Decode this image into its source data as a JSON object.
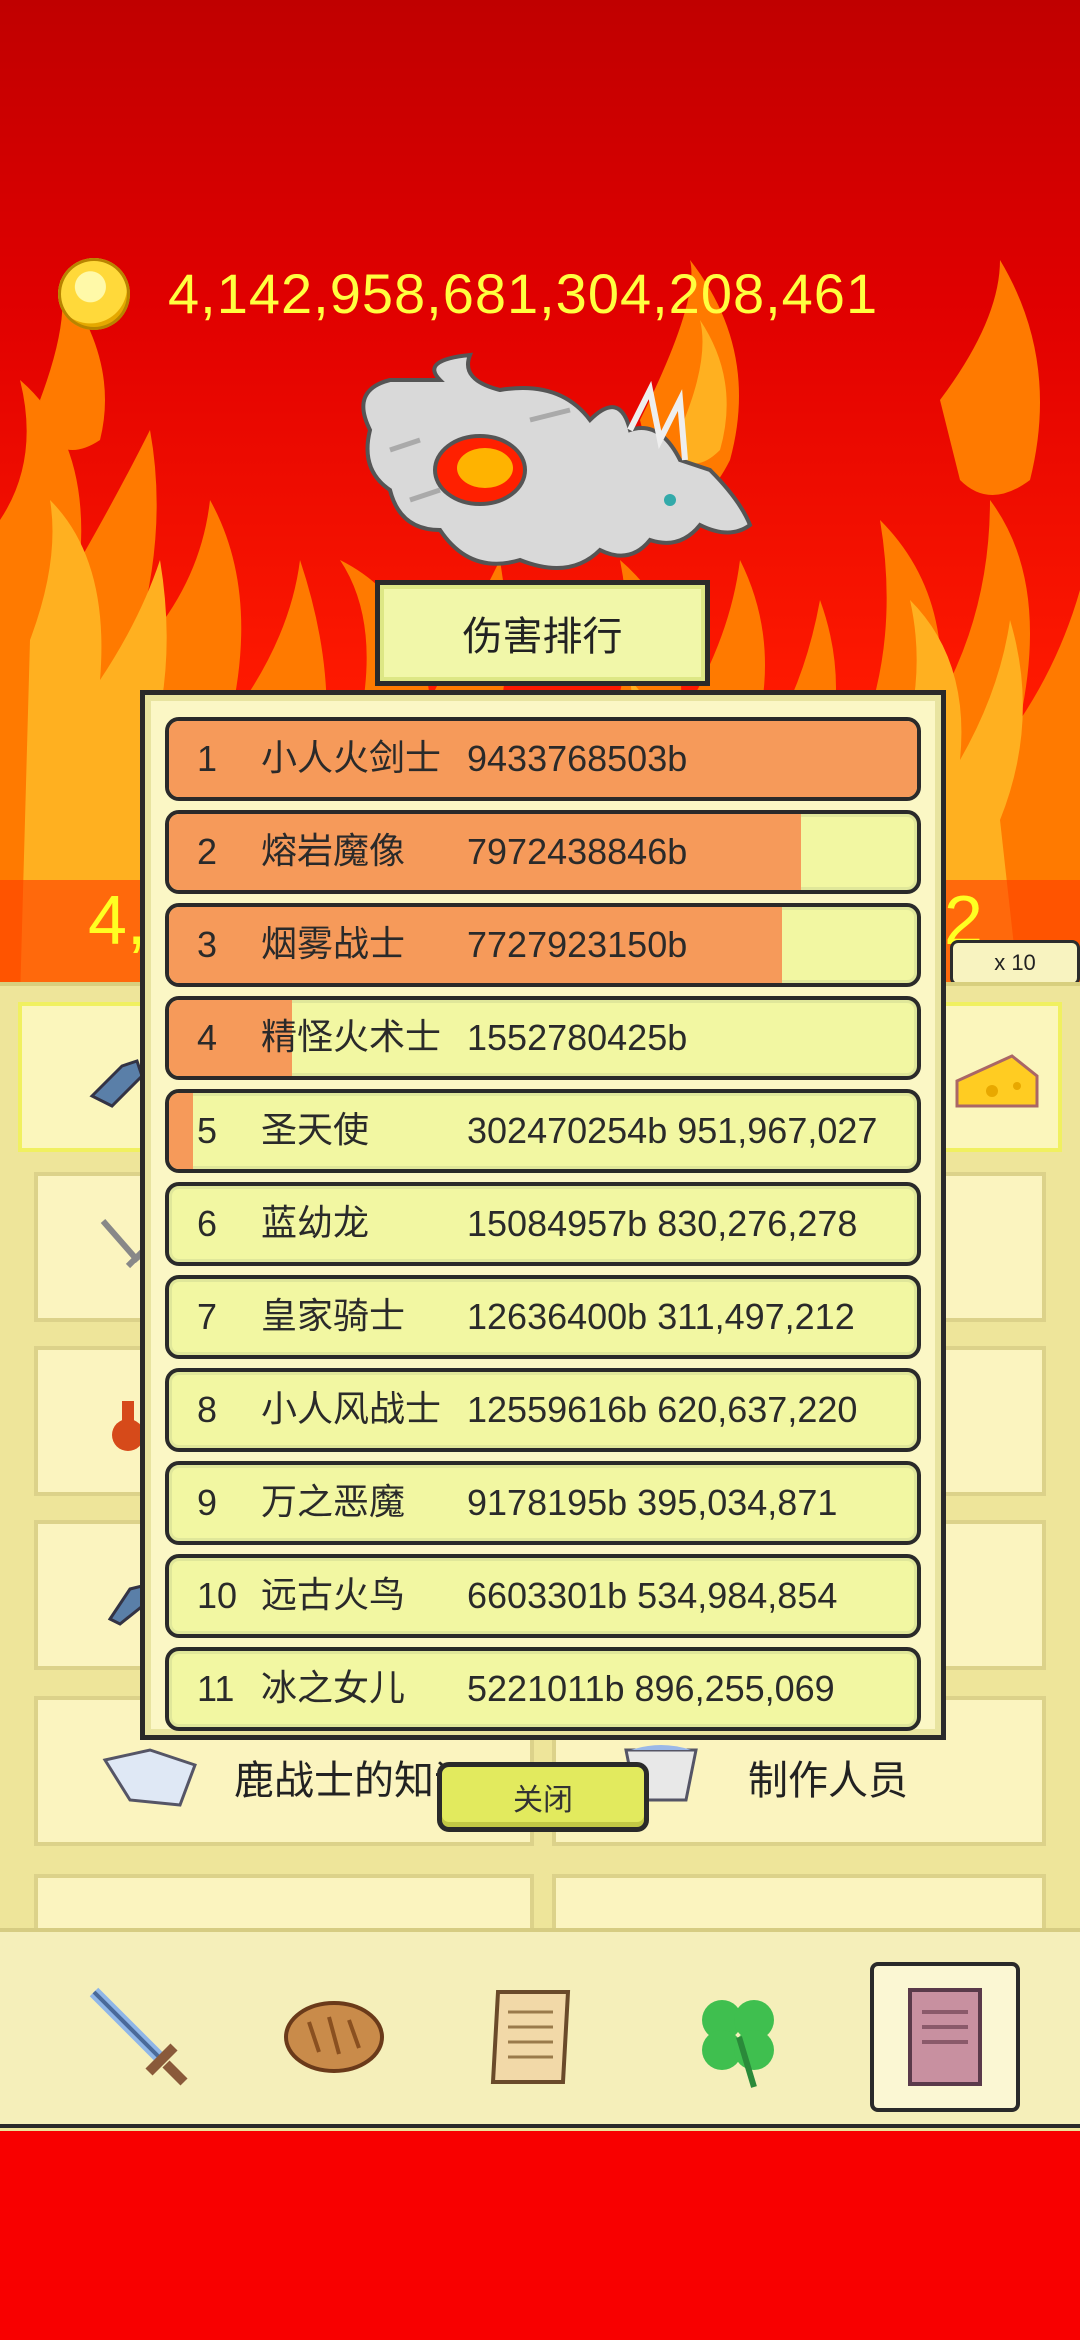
{
  "header": {
    "gold_amount": "4,142,958,681,304,208,461",
    "coin_icon": "gold-coin-icon"
  },
  "background": {
    "peek_left_text": "4,",
    "peek_right_text": "2",
    "multiplier_label": "x 10"
  },
  "panel": {
    "cards": [
      {
        "label": "鹿战士的知识",
        "icon": "open-book-icon"
      },
      {
        "label": "制作人员",
        "icon": "cup-icon"
      }
    ]
  },
  "popup": {
    "title": "伤害排行",
    "close_label": "关闭",
    "rows": [
      {
        "rank": "1",
        "name": "小人火剑士",
        "value": "9433768503b",
        "fill": 1.0
      },
      {
        "rank": "2",
        "name": "熔岩魔像",
        "value": "7972438846b",
        "fill": 0.845
      },
      {
        "rank": "3",
        "name": "烟雾战士",
        "value": "7727923150b",
        "fill": 0.819
      },
      {
        "rank": "4",
        "name": "精怪火术士",
        "value": "1552780425b",
        "fill": 0.165
      },
      {
        "rank": "5",
        "name": "圣天使",
        "value": "302470254b 951,967,027",
        "fill": 0.032
      },
      {
        "rank": "6",
        "name": "蓝幼龙",
        "value": "15084957b 830,276,278",
        "fill": 0.0
      },
      {
        "rank": "7",
        "name": "皇家骑士",
        "value": "12636400b 311,497,212",
        "fill": 0.0
      },
      {
        "rank": "8",
        "name": "小人风战士",
        "value": "12559616b 620,637,220",
        "fill": 0.0
      },
      {
        "rank": "9",
        "name": "万之恶魔",
        "value": "9178195b 395,034,871",
        "fill": 0.0
      },
      {
        "rank": "10",
        "name": "远古火鸟",
        "value": "6603301b 534,984,854",
        "fill": 0.0
      },
      {
        "rank": "11",
        "name": "冰之女儿",
        "value": "5221011b 896,255,069",
        "fill": 0.0
      }
    ]
  },
  "bottom_nav": {
    "items": [
      {
        "icon": "sword-icon",
        "selected": false
      },
      {
        "icon": "bread-icon",
        "selected": false
      },
      {
        "icon": "scroll-icon",
        "selected": false
      },
      {
        "icon": "clover-icon",
        "selected": false
      },
      {
        "icon": "book-icon",
        "selected": true
      }
    ]
  },
  "colors": {
    "bar_fill": "#f69a5a",
    "row_bg": "#f2f7a2",
    "gold_text": "#ffff40"
  }
}
